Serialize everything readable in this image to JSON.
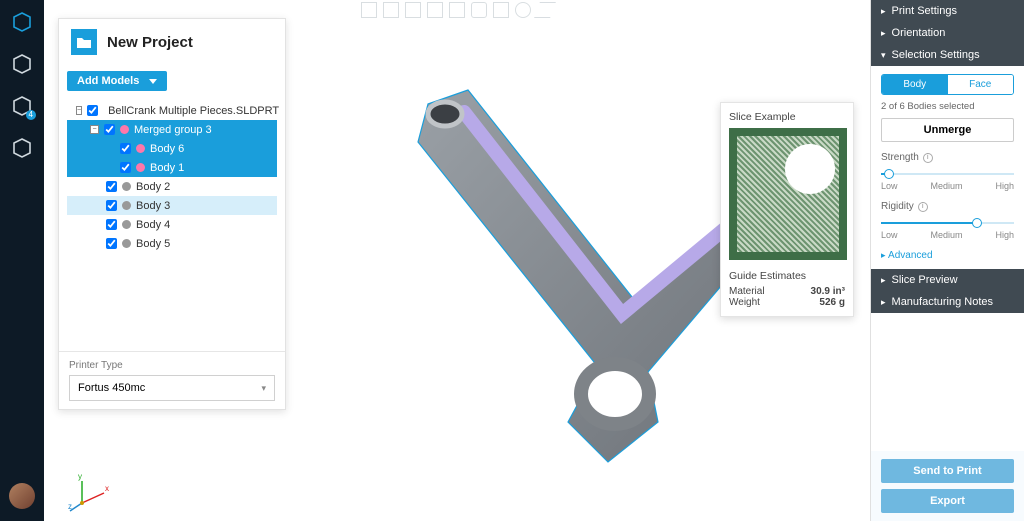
{
  "leftbar": {
    "items": [
      {
        "name": "cube-icon",
        "active": true
      },
      {
        "name": "add-to-scene-icon",
        "active": false
      },
      {
        "name": "history-icon",
        "badge": "4",
        "active": false
      },
      {
        "name": "recent-icon",
        "active": false
      }
    ]
  },
  "panel": {
    "title": "New Project",
    "add_models_label": "Add Models",
    "printer_type_label": "Printer Type",
    "printer_type_value": "Fortus 450mc",
    "tree": [
      {
        "depth": 0,
        "expander": "−",
        "checked": true,
        "icon": "assembly",
        "color": "#999",
        "label": "BellCrank Multiple Pieces.SLDPRT",
        "sel": false
      },
      {
        "depth": 1,
        "expander": "−",
        "checked": true,
        "icon": "group",
        "color": "#ff77aa",
        "label": "Merged group 3",
        "sel": true
      },
      {
        "depth": 2,
        "expander": "",
        "checked": true,
        "icon": "body",
        "color": "#ff77aa",
        "label": "Body 6",
        "sel": true
      },
      {
        "depth": 2,
        "expander": "",
        "checked": true,
        "icon": "body",
        "color": "#ff77aa",
        "label": "Body 1",
        "sel": true
      },
      {
        "depth": 1,
        "expander": "",
        "checked": true,
        "icon": "body",
        "color": "#999",
        "label": "Body 2",
        "sel": false
      },
      {
        "depth": 1,
        "expander": "",
        "checked": true,
        "icon": "body",
        "color": "#999",
        "label": "Body 3",
        "sel": false,
        "hov": true
      },
      {
        "depth": 1,
        "expander": "",
        "checked": true,
        "icon": "body",
        "color": "#999",
        "label": "Body 4",
        "sel": false
      },
      {
        "depth": 1,
        "expander": "",
        "checked": true,
        "icon": "body",
        "color": "#999",
        "label": "Body 5",
        "sel": false
      }
    ]
  },
  "popover": {
    "title": "Slice Example",
    "estimates_title": "Guide Estimates",
    "rows": [
      {
        "label": "Material",
        "value": "30.9 in³"
      },
      {
        "label": "Weight",
        "value": "526 g"
      }
    ]
  },
  "right": {
    "bands": {
      "print_settings": "Print Settings",
      "orientation": "Orientation",
      "selection_settings": "Selection Settings",
      "slice_preview": "Slice Preview",
      "manufacturing_notes": "Manufacturing Notes"
    },
    "seg_body": "Body",
    "seg_face": "Face",
    "selection_status": "2 of 6 Bodies selected",
    "unmerge": "Unmerge",
    "strength_label": "Strength",
    "rigidity_label": "Rigidity",
    "ticks": {
      "low": "Low",
      "med": "Medium",
      "high": "High"
    },
    "strength_pct": 6,
    "rigidity_pct": 72,
    "advanced": "Advanced",
    "send": "Send to Print",
    "export": "Export"
  }
}
